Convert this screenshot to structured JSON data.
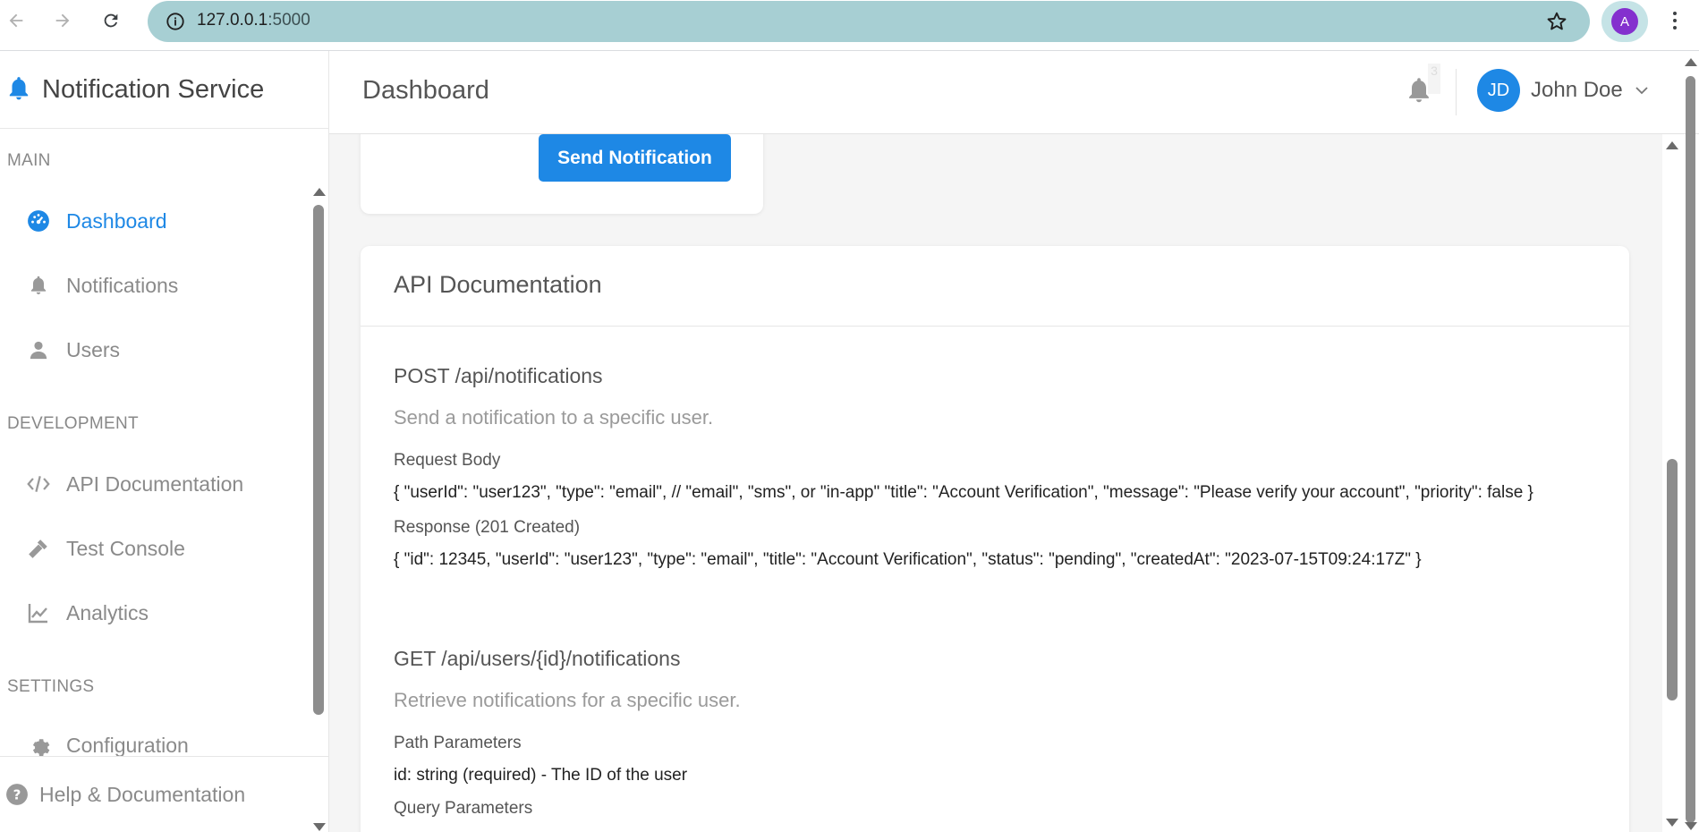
{
  "browser": {
    "url_host": "127.0.0.1",
    "url_port": ":5000",
    "profile_initial": "A"
  },
  "sidebar": {
    "brand": "Notification Service",
    "sections": {
      "main": "MAIN",
      "development": "DEVELOPMENT",
      "settings": "SETTINGS"
    },
    "items": [
      {
        "label": "Dashboard",
        "icon": "dashboard-icon",
        "active": true
      },
      {
        "label": "Notifications",
        "icon": "bell-icon"
      },
      {
        "label": "Users",
        "icon": "user-icon"
      },
      {
        "label": "API Documentation",
        "icon": "code-icon"
      },
      {
        "label": "Test Console",
        "icon": "hammer-icon"
      },
      {
        "label": "Analytics",
        "icon": "chart-line-icon"
      },
      {
        "label": "Configuration",
        "icon": "gear-icon"
      }
    ],
    "help": "Help & Documentation"
  },
  "header": {
    "title": "Dashboard",
    "badge_count": "3",
    "user_initials": "JD",
    "user_name": "John Doe"
  },
  "content": {
    "send_button": "Send Notification",
    "doc_title": "API Documentation",
    "endpoints": [
      {
        "title": "POST /api/notifications",
        "description": "Send a notification to a specific user.",
        "request_label": "Request Body",
        "request_body": "{ \"userId\": \"user123\", \"type\": \"email\", // \"email\", \"sms\", or \"in-app\" \"title\": \"Account Verification\", \"message\": \"Please verify your account\", \"priority\": false }",
        "response_label": "Response (201 Created)",
        "response_body": "{ \"id\": 12345, \"userId\": \"user123\", \"type\": \"email\", \"title\": \"Account Verification\", \"status\": \"pending\", \"createdAt\": \"2023-07-15T09:24:17Z\" }"
      },
      {
        "title": "GET /api/users/{id}/notifications",
        "description": "Retrieve notifications for a specific user.",
        "path_label": "Path Parameters",
        "path_value": "id: string (required) - The ID of the user",
        "query_label": "Query Parameters"
      }
    ]
  },
  "colors": {
    "accent": "#1e88e5",
    "omnibox": "#a7cfd3",
    "profile": "#8430ce"
  }
}
